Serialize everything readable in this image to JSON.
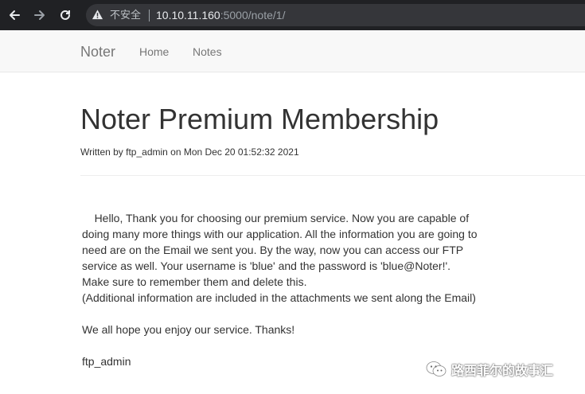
{
  "browser": {
    "security_label": "不安全",
    "url_host": "10.10.11.160",
    "url_rest": ":5000/note/1/"
  },
  "navbar": {
    "brand": "Noter",
    "links": [
      {
        "label": "Home"
      },
      {
        "label": "Notes"
      }
    ]
  },
  "note": {
    "title": "Noter Premium Membership",
    "byline": "Written by ftp_admin on Mon Dec 20 01:52:32 2021",
    "paragraphs": [
      "    Hello, Thank you for choosing our premium service. Now you are capable of doing many more things with our application. All the information you are going to need are on the Email we sent you. By the way, now you can access our FTP service as well. Your username is 'blue' and the password is 'blue@Noter!'.\nMake sure to remember them and delete this.\n(Additional information are included in the attachments we sent along the Email)",
      "We all hope you enjoy our service. Thanks!",
      "ftp_admin"
    ]
  },
  "watermark": {
    "text": "路西菲尔的故事汇"
  },
  "icons": {
    "back": "arrow-left-icon",
    "forward": "arrow-right-icon",
    "reload": "reload-icon",
    "warning": "warning-triangle-icon",
    "watermark": "wechat-icon"
  }
}
